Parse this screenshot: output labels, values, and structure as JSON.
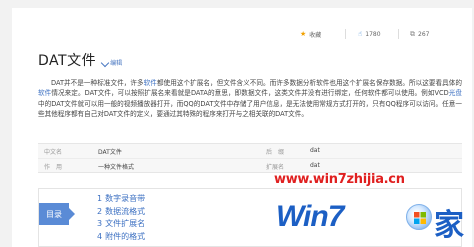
{
  "toolbar": {
    "favorite_label": "收藏",
    "like_count": "1780",
    "share_count": "267"
  },
  "article": {
    "title": "DAT文件",
    "edit_label": "编辑",
    "paragraph": {
      "p1": "DAT并不是一种标准文件，许多",
      "link1": "软件",
      "p2": "都使用这个扩展名，但文件含义不同。而许多数据分析软件也用这个扩展名保存数据。所以这要看具体的",
      "link2": "软件",
      "p3": "情况来定。DAT文件，可以按照扩展名来看就是DATA的意思，即数据文件，这类文件并没有进行绑定，任何软件都可以使用。例如VCD",
      "link3": "光盘",
      "p4": "中的DAT文件就可以用一般的视频播放器打开，而QQ的DAT文件中存储了用户信息，是无法使用常规方式打开的，只有QQ程序可以访问。任意一些其他程序都有自己对DAT文件的定义，要通过其特殊的程序来打开与之相关联的DAT文件。"
    }
  },
  "info": {
    "row1": {
      "k1": "中文名",
      "v1": "DAT文件",
      "k2": "后　缀",
      "v2": "dat"
    },
    "row2": {
      "k1": "作　用",
      "v1": "一种文件格式",
      "k2": "扩展名",
      "v2": "dat"
    }
  },
  "toc": {
    "tag": "目录",
    "items": [
      {
        "num": "1",
        "label": "数字录音带"
      },
      {
        "num": "2",
        "label": "数据流格式"
      },
      {
        "num": "3",
        "label": "文件扩展名"
      },
      {
        "num": "4",
        "label": "附件的格式"
      }
    ]
  },
  "watermark": {
    "url": "www.win7zhijia.cn",
    "brand": "Win7",
    "char": "家"
  },
  "colors": {
    "accent": "#3c70c2",
    "toc_tag": "#5a8bd6",
    "watermark_red": "#e02020",
    "watermark_blue": "#1c5fc4"
  },
  "icons": [
    "star-icon",
    "thumb-up-icon",
    "share-icon",
    "pencil-icon"
  ]
}
